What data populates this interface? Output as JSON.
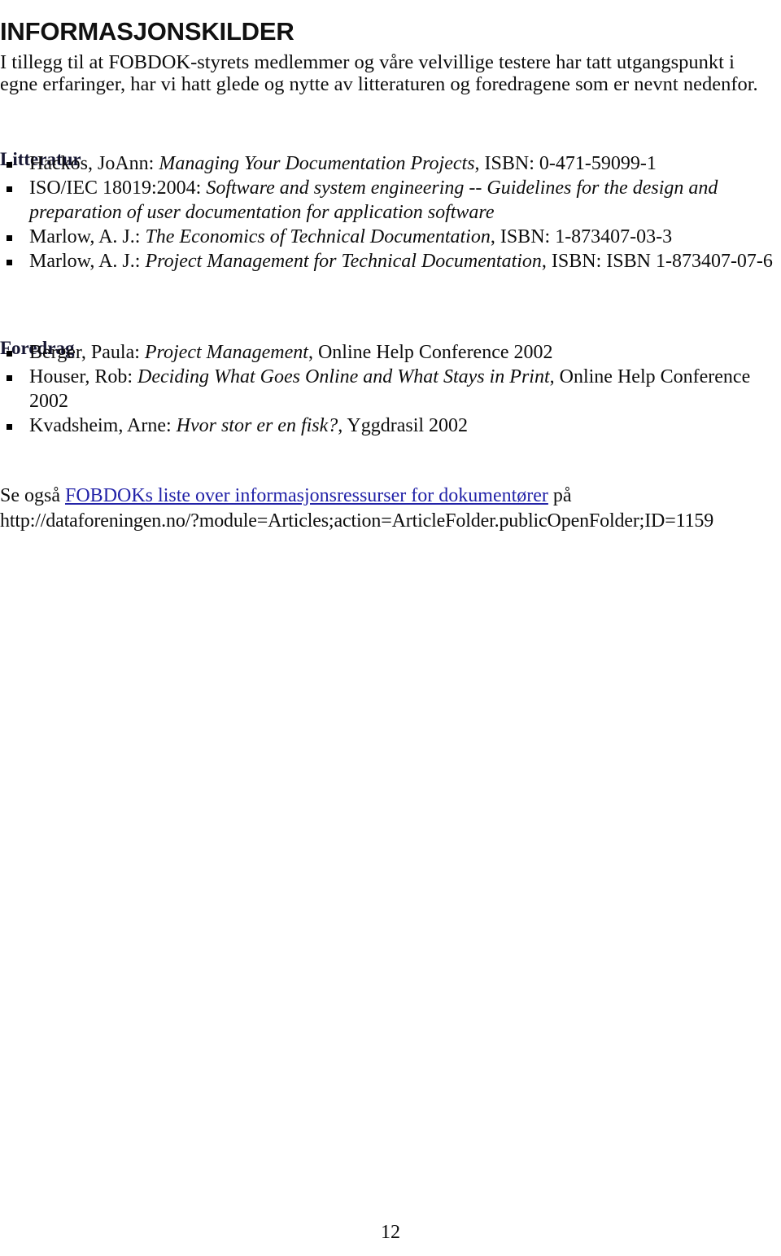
{
  "document": {
    "title": "INFORMASJONSKILDER",
    "intro": "I tillegg til at FOBDOK-styrets medlemmer og våre velvillige testere har tatt utgangspunkt i egne erfaringer, har vi hatt glede og nytte av litteraturen og foredragene som er nevnt nedenfor.",
    "page_number": "12"
  },
  "sections": {
    "litteratur": {
      "heading": "Litteratur",
      "items": [
        {
          "author": "Hackos, JoAnn: ",
          "title": "Managing Your Documentation Projects",
          "trailing": ", ISBN: 0-471-59099-1"
        },
        {
          "author": "ISO/IEC 18019:2004: ",
          "title": "Software and system engineering -- Guidelines for the design and preparation of user documentation for application software",
          "trailing": ""
        },
        {
          "author": "Marlow, A. J.: ",
          "title": "The Economics of Technical Documentation",
          "trailing": ", ISBN: 1-873407-03-3"
        },
        {
          "author": "Marlow, A. J.: ",
          "title": "Project Management for Technical Documentation",
          "trailing": ", ISBN: ISBN 1-873407-07-6"
        }
      ]
    },
    "foredrag": {
      "heading": "Foredrag",
      "items": [
        {
          "author": "Berger, Paula: ",
          "title": "Project Management",
          "trailing": ", Online Help Conference 2002"
        },
        {
          "author": "Houser, Rob: ",
          "title": "Deciding What Goes Online and What Stays in Print",
          "trailing": ", Online Help Conference 2002"
        },
        {
          "author": "Kvadsheim, Arne: ",
          "title": "Hvor stor er en fisk?",
          "trailing": ", Yggdrasil 2002"
        }
      ]
    }
  },
  "see_also": {
    "prefix": "Se også ",
    "link_text": "FOBDOKs liste over informasjonsressurser for dokumentører",
    "suffix": " på",
    "url": "http://dataforeningen.no/?module=Articles;action=ArticleFolder.publicOpenFolder;ID=1159",
    "link_color": "#2323a8"
  }
}
